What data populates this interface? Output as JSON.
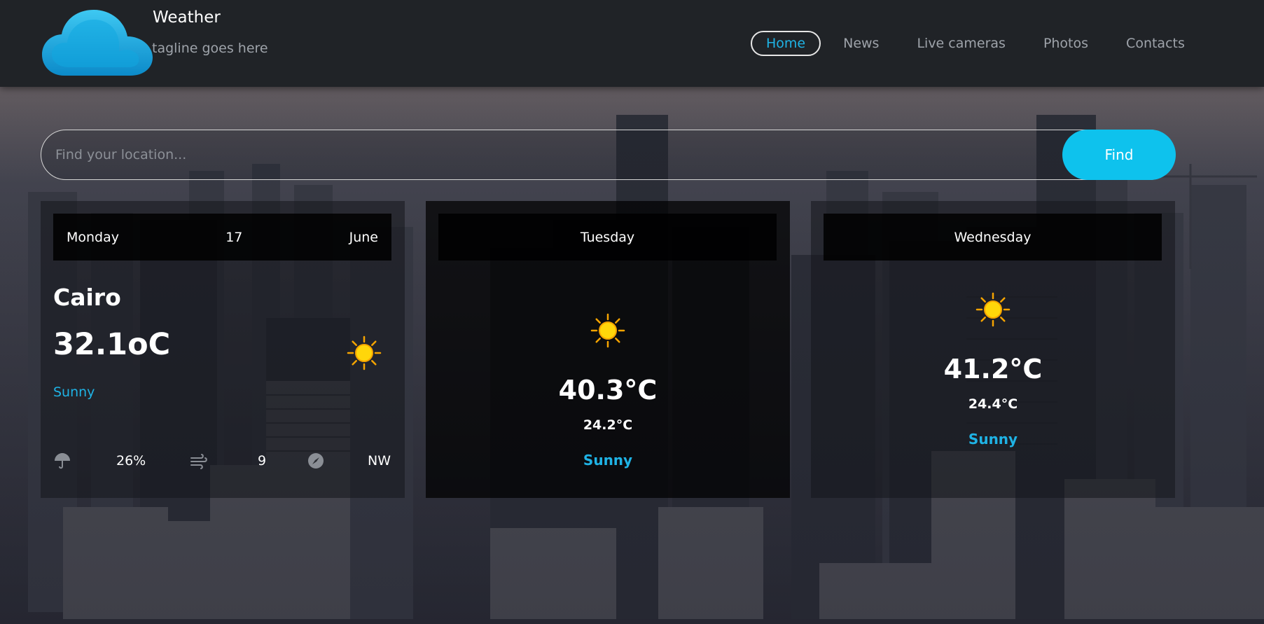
{
  "brand": {
    "title": "Weather",
    "tagline": "tagline goes here",
    "logo_icon": "cloud-logo-icon"
  },
  "nav": {
    "items": [
      {
        "label": "Home",
        "active": true
      },
      {
        "label": "News"
      },
      {
        "label": "Live cameras"
      },
      {
        "label": "Photos"
      },
      {
        "label": "Contacts"
      }
    ]
  },
  "search": {
    "placeholder": "Find your location...",
    "value": "",
    "button_label": "Find"
  },
  "today": {
    "day": "Monday",
    "date": "17",
    "month": "June",
    "city": "Cairo",
    "temperature": "32.1oC",
    "condition": "Sunny",
    "condition_icon": "sun-icon",
    "stats": {
      "rain": "26%",
      "wind_speed": "9",
      "wind_direction": "NW"
    }
  },
  "forecast": [
    {
      "day": "Tuesday",
      "max_temp": "40.3°C",
      "min_temp": "24.2°C",
      "condition": "Sunny",
      "icon": "sun-icon"
    },
    {
      "day": "Wednesday",
      "max_temp": "41.2°C",
      "min_temp": "24.4°C",
      "condition": "Sunny",
      "icon": "sun-icon"
    }
  ],
  "colors": {
    "accent": "#0ec2ed",
    "accent_text": "#1fb3e5",
    "header_bg": "#202327"
  }
}
